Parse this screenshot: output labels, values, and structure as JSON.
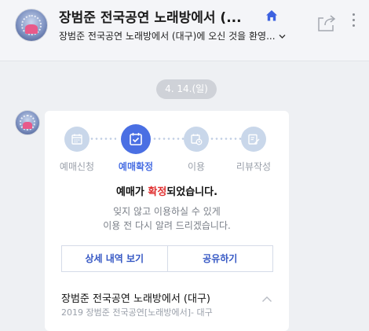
{
  "header": {
    "title": "장범준 전국공연 노래방에서 (...",
    "subtitle": "장범준 전국공연 노래방에서 (대구)에 오신 것을 환영..."
  },
  "icons": {
    "home": "home-icon",
    "share": "share-icon",
    "more": "more-vertical-icon",
    "subtitle_expand": "chevron-down-icon"
  },
  "date_divider": "4. 14.(일)",
  "card": {
    "steps": [
      {
        "label": "예매신청",
        "icon": "calendar-icon",
        "active": false
      },
      {
        "label": "예매확정",
        "icon": "calendar-check-icon",
        "active": true
      },
      {
        "label": "이용",
        "icon": "calendar-clock-icon",
        "active": false
      },
      {
        "label": "리뷰작성",
        "icon": "edit-icon",
        "active": false
      }
    ],
    "headline_prefix": "예매가 ",
    "headline_accent": "확정",
    "headline_suffix": "되었습니다.",
    "desc_line1": "잊지 않고 이용하실 수 있게",
    "desc_line2": "이용 전 다시 알려 드리겠습니다.",
    "detail_button": "상세 내역 보기",
    "share_button": "공유하기",
    "place_name": "장범준 전국공연 노래방에서 (대구)",
    "place_sub": "2019 장범준 전국공연[노래방에서]- 대구"
  },
  "colors": {
    "accent": "#4a6fe3",
    "highlight": "#e03131",
    "button_text": "#3557c4",
    "inactive_step": "#c9d7ea"
  }
}
